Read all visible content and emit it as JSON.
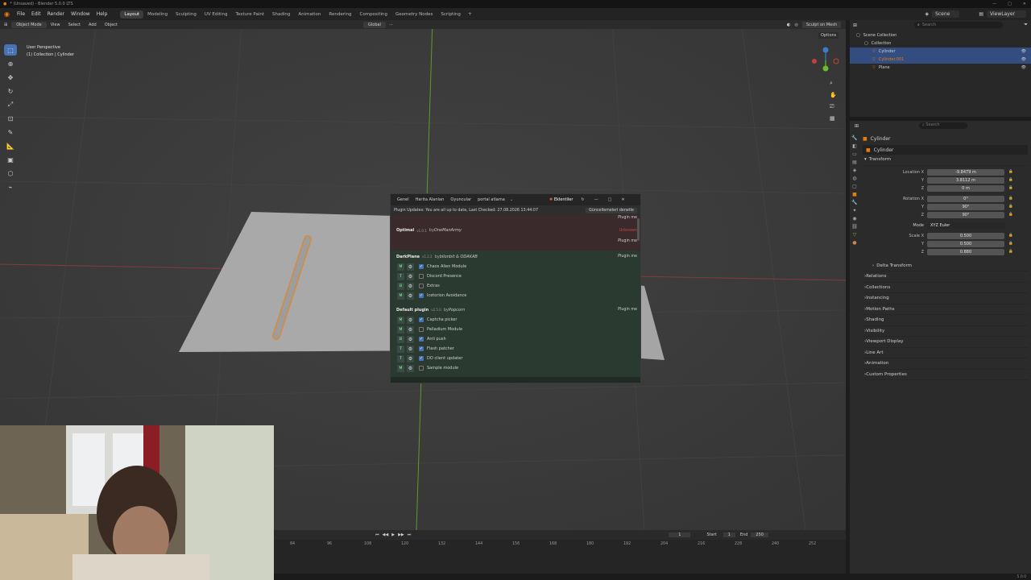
{
  "window_title": "* (Unsaved) - Blender 5.0.0 LTS",
  "menu": [
    "File",
    "Edit",
    "Render",
    "Window",
    "Help"
  ],
  "workspaces": [
    "Layout",
    "Modeling",
    "Sculpting",
    "UV Editing",
    "Texture Paint",
    "Shading",
    "Animation",
    "Rendering",
    "Compositing",
    "Geometry Nodes",
    "Scripting"
  ],
  "top_right": {
    "scene": "Scene",
    "view_layer": "ViewLayer"
  },
  "viewport_header": {
    "mode": "Object Mode",
    "items": [
      "View",
      "Select",
      "Add",
      "Object"
    ],
    "orientation": "Global",
    "sculpt_btn": "Sculpt on Mesh",
    "options": "Options"
  },
  "viewport_info": {
    "line1": "User Perspective",
    "line2": "(1) Collection | Cylinder"
  },
  "outliner": {
    "search_placeholder": "Search",
    "rows": [
      {
        "label": "Scene Collection",
        "indent": 0,
        "selected": false
      },
      {
        "label": "Collection",
        "indent": 1,
        "selected": false
      },
      {
        "label": "Cylinder",
        "indent": 2,
        "selected": true
      },
      {
        "label": "Cylinder.001",
        "indent": 2,
        "selected": true
      },
      {
        "label": "Plane",
        "indent": 2,
        "selected": false
      }
    ]
  },
  "properties": {
    "object_name": "Cylinder",
    "object_field": "Cylinder",
    "transform_title": "Transform",
    "location": {
      "label": "Location X",
      "x": "-9.8479 m",
      "y": "3.8112 m",
      "z": "0 m"
    },
    "rotation": {
      "label": "Rotation X",
      "x": "0°",
      "y": "90°",
      "z": "90°"
    },
    "mode_label": "Mode",
    "mode_value": "XYZ Euler",
    "scale": {
      "label": "Scale X",
      "x": "0.500",
      "y": "0.500",
      "z": "0.880"
    },
    "delta": "Delta Transform",
    "sections": [
      "Relations",
      "Collections",
      "Instancing",
      "Motion Paths",
      "Shading",
      "Visibility",
      "Viewport Display",
      "Line Art",
      "Animation",
      "Custom Properties"
    ]
  },
  "dialog": {
    "tabs": [
      "Genel",
      "Harita Alanları",
      "Oyuncular",
      "portal atlama"
    ],
    "active_tab": "Eklentiler",
    "status": "Plugin Updates: You are all up to date, Last Checked: 27.08.2026 13:44:07",
    "check_btn": "Güncellemeleri denetle",
    "top_btn": "Plugin me",
    "plugins": [
      {
        "name": "Optimal",
        "version": "v1.0.1",
        "author": "OneManArmy",
        "status": "Unknown",
        "btn": "Plugin me",
        "bg": "#3a2a2c",
        "modules": []
      },
      {
        "name": "DarkPlane",
        "version": "v1.2.2",
        "author": "bilonbit & ODAKAB",
        "btn": "Plugin me",
        "bg": "#2a3a30",
        "modules": [
          {
            "key": "M",
            "label": "Chaos Alien Module",
            "checked": true
          },
          {
            "key": "T",
            "label": "Discord Presence",
            "checked": false
          },
          {
            "key": "B",
            "label": "Extras",
            "checked": false
          },
          {
            "key": "M",
            "label": "Icetorion Avoidance",
            "checked": true
          }
        ]
      },
      {
        "name": "Default plugin",
        "version": "v2.5.0",
        "author": "Popcorn",
        "btn": "Plugin me",
        "bg": "#2a3a30",
        "modules": [
          {
            "key": "M",
            "label": "Captcha picker",
            "checked": true
          },
          {
            "key": "M",
            "label": "Palladium Module",
            "checked": false
          },
          {
            "key": "B",
            "label": "Anti push",
            "checked": true
          },
          {
            "key": "T",
            "label": "Flash patcher",
            "checked": true
          },
          {
            "key": "T",
            "label": "DO client updater",
            "checked": true
          },
          {
            "key": "M",
            "label": "Sample module",
            "checked": false
          }
        ]
      }
    ]
  },
  "timeline": {
    "frame": "1",
    "start_label": "Start",
    "start": "1",
    "end_label": "End",
    "end": "250",
    "ticks": [
      "84",
      "96",
      "108",
      "120",
      "132",
      "144",
      "156",
      "168",
      "180",
      "192",
      "204",
      "216",
      "228",
      "240",
      "252"
    ]
  },
  "version": "5.0.0",
  "colors": {
    "accent": "#4772b3",
    "selected_row": "#334d80",
    "unknown": "#d04545",
    "x_axis": "#c83c3c",
    "y_axis": "#6fba2c",
    "dialog_green": "#2a3a30",
    "dialog_red": "#3a2a2c"
  }
}
